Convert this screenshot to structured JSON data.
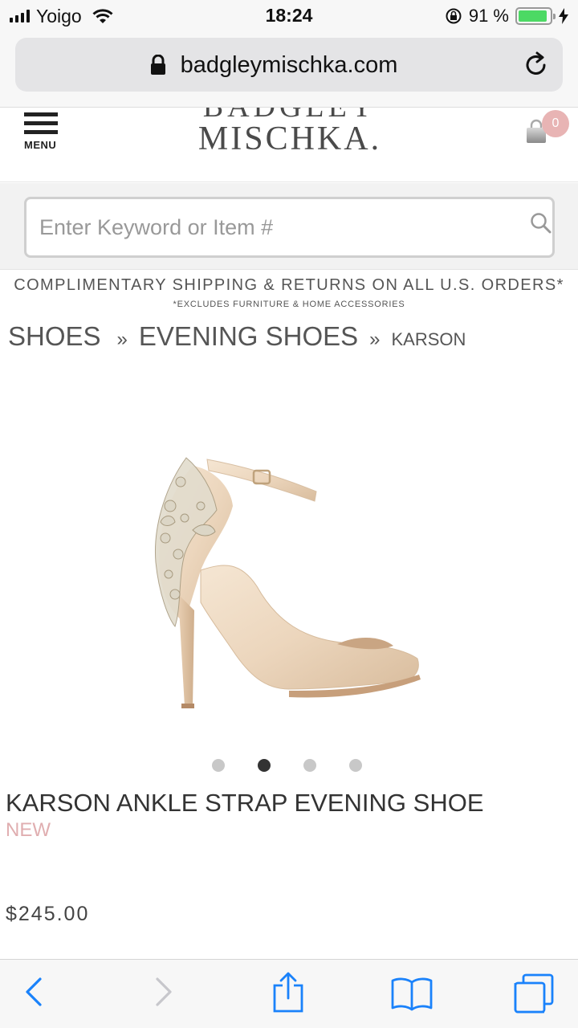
{
  "status_bar": {
    "carrier": "Yoigo",
    "time": "18:24",
    "battery_percent": "91 %",
    "battery_level": 0.91,
    "signal_bars": 4
  },
  "browser": {
    "url": "badgleymischka.com"
  },
  "header": {
    "menu_label": "MENU",
    "logo_top": "BADGLEY",
    "logo_bottom": "MISCHKA.",
    "cart_count": "0"
  },
  "search": {
    "placeholder": "Enter Keyword or Item #"
  },
  "promo": {
    "main": "COMPLIMENTARY SHIPPING & RETURNS ON ALL U.S. ORDERS*",
    "sub": "*EXCLUDES FURNITURE & HOME ACCESSORIES"
  },
  "breadcrumb": {
    "items": [
      "SHOES",
      "EVENING SHOES",
      "KARSON"
    ],
    "separator": "»"
  },
  "product": {
    "image_alt": "Karson ankle strap evening shoe",
    "title": "KARSON ANKLE STRAP EVENING SHOE",
    "badge": "NEW",
    "price": "$245.00",
    "carousel_total": 4,
    "carousel_active_index": 1
  },
  "colors": {
    "badge": "#e0aeb0",
    "battery": "#4cd964",
    "ios_blue": "#1a82fb"
  }
}
